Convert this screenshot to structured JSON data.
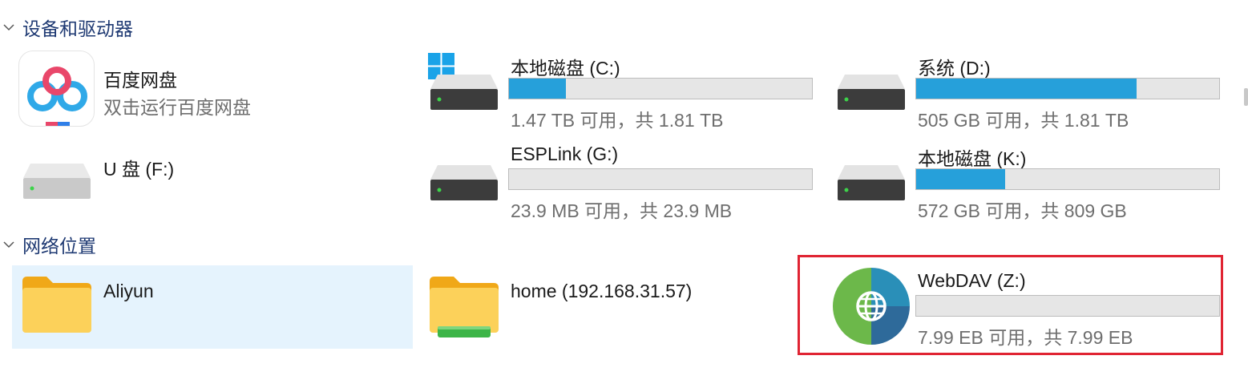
{
  "sections": {
    "devices": {
      "title": "设备和驱动器"
    },
    "network": {
      "title": "网络位置"
    }
  },
  "devices": {
    "baidu": {
      "name": "百度网盘",
      "subtitle": "双击运行百度网盘",
      "icon": "baidu-netdisk-icon"
    },
    "usb": {
      "name": "U 盘 (F:)",
      "icon": "drive-icon"
    },
    "c": {
      "name": "本地磁盘 (C:)",
      "free": "1.47 TB 可用，共 1.81 TB",
      "used_fraction": 0.188,
      "icon": "windows-system-drive-icon"
    },
    "d": {
      "name": "系统 (D:)",
      "free": "505 GB 可用，共 1.81 TB",
      "used_fraction": 0.727,
      "icon": "drive-icon"
    },
    "g": {
      "name": "ESPLink (G:)",
      "free": "23.9 MB 可用，共 23.9 MB",
      "used_fraction": 0.0,
      "icon": "drive-icon"
    },
    "k": {
      "name": "本地磁盘 (K:)",
      "free": "572 GB 可用，共 809 GB",
      "used_fraction": 0.293,
      "icon": "drive-icon"
    }
  },
  "network": {
    "aliyun": {
      "name": "Aliyun",
      "icon": "folder-icon"
    },
    "home": {
      "name": "home (192.168.31.57)",
      "icon": "network-folder-icon"
    },
    "webdav": {
      "name": "WebDAV (Z:)",
      "free": "7.99 EB 可用，共 7.99 EB",
      "used_fraction": 0.0,
      "icon": "webdav-globe-icon"
    }
  },
  "colors": {
    "bar_fill": "#26a0da",
    "bar_bg": "#e6e6e6",
    "header_text": "#1f3a73",
    "selection": "#e5f3fd",
    "highlight": "#e02433"
  }
}
